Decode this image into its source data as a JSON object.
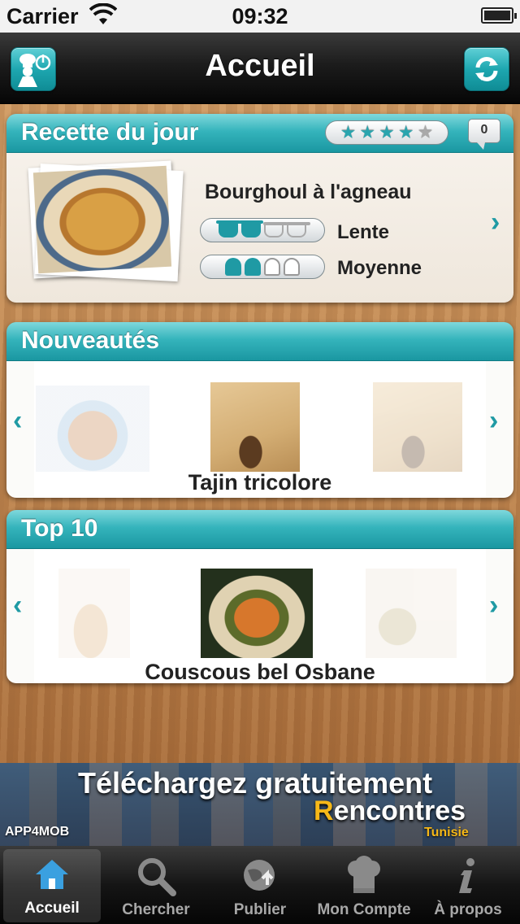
{
  "status_bar": {
    "carrier": "Carrier",
    "time": "09:32"
  },
  "nav": {
    "title": "Accueil",
    "left_icon": "chef-power-icon",
    "right_icon": "refresh-icon"
  },
  "recette_du_jour": {
    "header": "Recette du jour",
    "rating": 4.5,
    "rating_max": 5,
    "comments_count": "0",
    "recipe_name": "Bourghoul à l'agneau",
    "time_level": 2,
    "time_label": "Lente",
    "difficulty_level": 2,
    "difficulty_label": "Moyenne",
    "accent_color": "#1f9aa4"
  },
  "nouveautes": {
    "header": "Nouveautés",
    "current_title": "Tajin tricolore"
  },
  "top10": {
    "header": "Top 10",
    "current_title": "Couscous bel Osbane"
  },
  "ad_banner": {
    "line1": "Téléchargez gratuitement",
    "line2_first": "R",
    "line2_rest": "encontres",
    "line3": "Tunisie",
    "logo": "APP4MOB"
  },
  "tabs": [
    {
      "label": "Accueil",
      "icon": "home-icon",
      "active": true
    },
    {
      "label": "Chercher",
      "icon": "search-icon",
      "active": false
    },
    {
      "label": "Publier",
      "icon": "publish-globe-icon",
      "active": false
    },
    {
      "label": "Mon Compte",
      "icon": "chef-hat-icon",
      "active": false
    },
    {
      "label": "À propos",
      "icon": "info-icon",
      "active": false
    }
  ]
}
